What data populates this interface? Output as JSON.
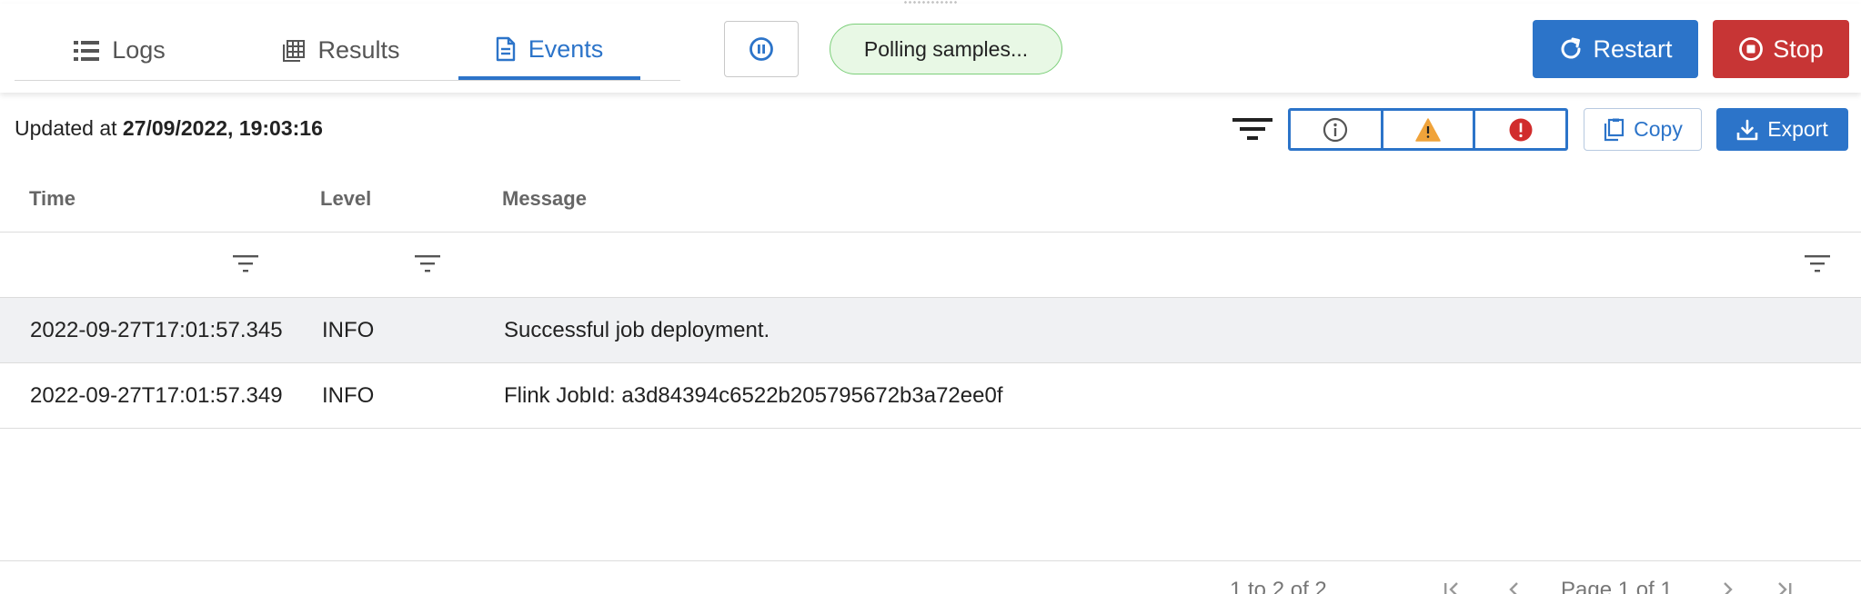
{
  "tabs": [
    {
      "label": "Logs",
      "icon": "list-icon",
      "active": false
    },
    {
      "label": "Results",
      "icon": "table-icon",
      "active": false
    },
    {
      "label": "Events",
      "icon": "document-icon",
      "active": true
    }
  ],
  "toolbar": {
    "pause_icon": "pause-icon",
    "status_text": "Polling samples...",
    "restart_label": "Restart",
    "stop_label": "Stop"
  },
  "updated": {
    "prefix": "Updated at",
    "timestamp": "27/09/2022, 19:03:16"
  },
  "level_filters": [
    {
      "icon": "info-icon",
      "color": "#555555"
    },
    {
      "icon": "warning-icon",
      "color": "#f0a33a"
    },
    {
      "icon": "error-icon",
      "color": "#d12c2c"
    }
  ],
  "actions": {
    "copy_label": "Copy",
    "export_label": "Export"
  },
  "table": {
    "columns": [
      "Time",
      "Level",
      "Message"
    ],
    "rows": [
      {
        "time": "2022-09-27T17:01:57.345",
        "level": "INFO",
        "message": "Successful job deployment."
      },
      {
        "time": "2022-09-27T17:01:57.349",
        "level": "INFO",
        "message": "Flink JobId: a3d84394c6522b205795672b3a72ee0f"
      }
    ]
  },
  "pager": {
    "range": "1 to 2 of 2",
    "page": "Page 1 of 1"
  },
  "colors": {
    "accent": "#2c74c9",
    "stop": "#c73535",
    "status_bg": "#e8f8e5",
    "status_border": "#7ccf7a"
  }
}
